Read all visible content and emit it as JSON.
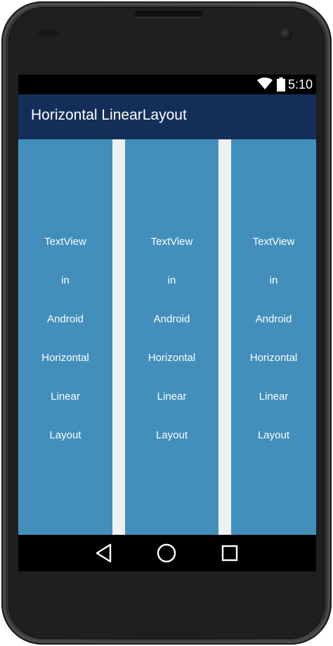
{
  "status_bar": {
    "time": "5:10",
    "icons": [
      "wifi-icon",
      "battery-icon"
    ]
  },
  "app_bar": {
    "title": "Horizontal LinearLayout",
    "color": "#132f59"
  },
  "columns": [
    {
      "words": [
        "TextView",
        "in",
        "Android",
        "Horizontal",
        "Linear",
        "Layout"
      ]
    },
    {
      "words": [
        "TextView",
        "in",
        "Android",
        "Horizontal",
        "Linear",
        "Layout"
      ]
    },
    {
      "words": [
        "TextView",
        "in",
        "Android",
        "Horizontal",
        "Linear",
        "Layout"
      ]
    }
  ],
  "colors": {
    "column_background": "#428fbb",
    "divider": "#eef0f3",
    "text": "#ffffff"
  },
  "navigation_bar": {
    "buttons": [
      "back-icon",
      "home-icon",
      "recents-icon"
    ]
  }
}
